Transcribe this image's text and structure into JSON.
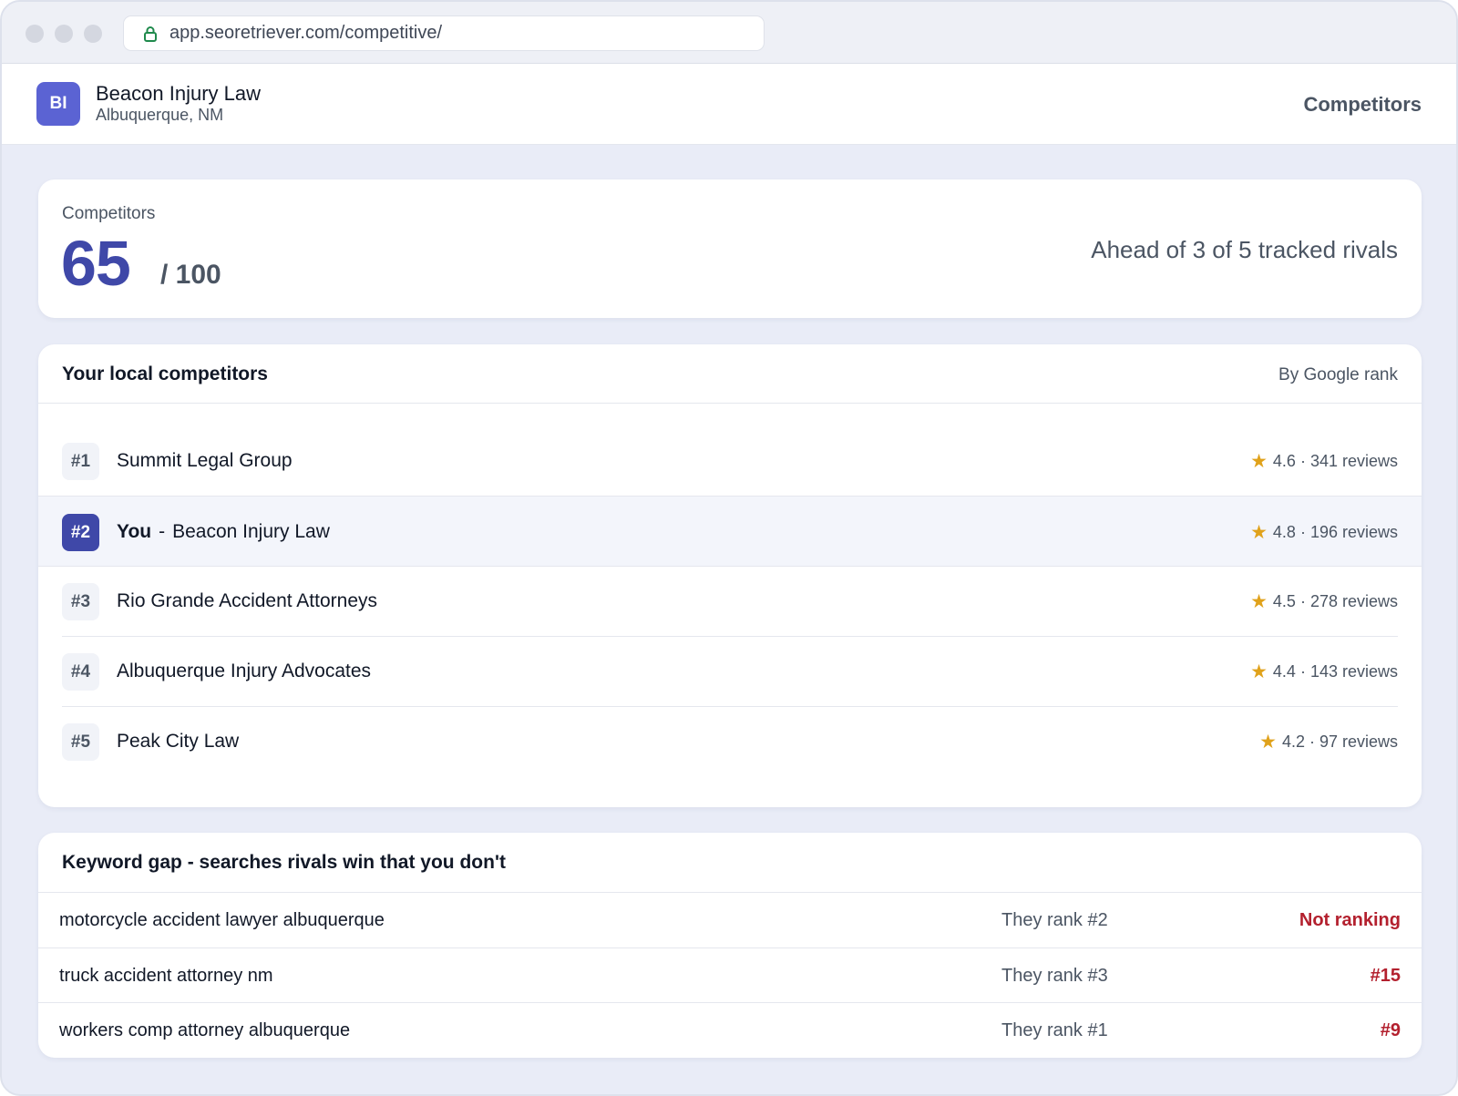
{
  "browser": {
    "url": "app.seoretriever.com/competitive/"
  },
  "header": {
    "avatar_initials": "BI",
    "business_name": "Beacon Injury Law",
    "location": "Albuquerque, NM",
    "nav_label": "Competitors"
  },
  "score": {
    "label": "Competitors",
    "value": "65",
    "max": "/ 100",
    "summary": "Ahead of 3 of 5 tracked rivals"
  },
  "competitors": {
    "title": "Your local competitors",
    "sort_label": "By Google rank",
    "items": [
      {
        "rank": "#1",
        "name": "Summit Legal Group",
        "stats": "4.6 · 341 reviews"
      },
      {
        "rank": "#2",
        "you_label": "You",
        "dash": "-",
        "name": "Beacon Injury Law",
        "stats": "4.8 · 196 reviews"
      },
      {
        "rank": "#3",
        "name": "Rio Grande Accident Attorneys",
        "stats": "4.5 · 278 reviews"
      },
      {
        "rank": "#4",
        "name": "Albuquerque Injury Advocates",
        "stats": "4.4 · 143 reviews"
      },
      {
        "rank": "#5",
        "name": "Peak City Law",
        "stats": "4.2 · 97 reviews"
      }
    ]
  },
  "keyword_gap": {
    "title": "Keyword gap - searches rivals win that you don't",
    "rows": [
      {
        "keyword": "motorcycle accident lawyer albuquerque",
        "they_rank": "They rank #2",
        "your_rank": "Not ranking"
      },
      {
        "keyword": "truck accident attorney nm",
        "they_rank": "They rank #3",
        "your_rank": "#15"
      },
      {
        "keyword": "workers comp attorney albuquerque",
        "they_rank": "They rank #1",
        "your_rank": "#9"
      }
    ]
  },
  "colors": {
    "accent": "#3f48a8",
    "avatar": "#5b63d3",
    "star": "#e0a21b",
    "alert": "#b3202e"
  }
}
